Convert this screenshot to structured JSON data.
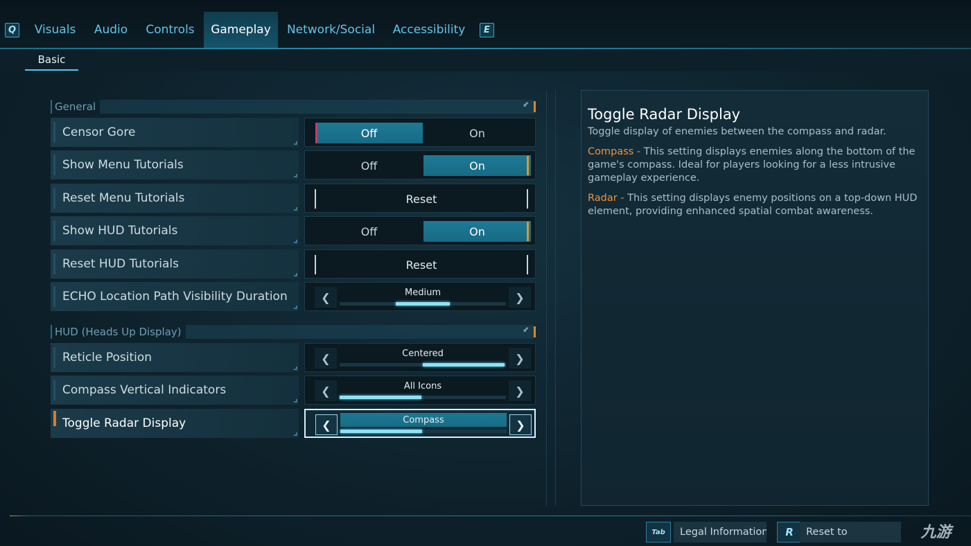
{
  "tabs": {
    "prev_key": "Q",
    "next_key": "E",
    "items": [
      "Visuals",
      "Audio",
      "Controls",
      "Gameplay",
      "Network/Social",
      "Accessibility"
    ],
    "active": "Gameplay"
  },
  "subtabs": {
    "active": "Basic"
  },
  "sections": {
    "general": "General",
    "hud": "HUD (Heads Up Display)"
  },
  "settings": {
    "censor_gore": {
      "label": "Censor Gore",
      "off": "Off",
      "on": "On",
      "value": "Off"
    },
    "show_menu_tutorials": {
      "label": "Show Menu Tutorials",
      "off": "Off",
      "on": "On",
      "value": "On"
    },
    "reset_menu_tutorials": {
      "label": "Reset Menu Tutorials",
      "button": "Reset"
    },
    "show_hud_tutorials": {
      "label": "Show HUD Tutorials",
      "off": "Off",
      "on": "On",
      "value": "On"
    },
    "reset_hud_tutorials": {
      "label": "Reset HUD Tutorials",
      "button": "Reset"
    },
    "echo_path_duration": {
      "label": "ECHO Location Path Visibility Duration",
      "value": "Medium",
      "position": 2,
      "options_count": 3
    },
    "reticle_position": {
      "label": "Reticle Position",
      "value": "Centered",
      "position": 2,
      "options_count": 2
    },
    "compass_vertical_indicators": {
      "label": "Compass Vertical Indicators",
      "value": "All Icons",
      "position": 1,
      "options_count": 2
    },
    "toggle_radar_display": {
      "label": "Toggle Radar Display",
      "value": "Compass",
      "position": 1,
      "options_count": 2
    }
  },
  "description": {
    "title": "Toggle Radar Display",
    "intro": "Toggle display of enemies between the compass and radar.",
    "compass_term": "Compass - ",
    "compass_text": "This setting displays enemies along the bottom of the game's compass. Ideal for players looking for a less intrusive gameplay experience.",
    "radar_term": "Radar - ",
    "radar_text": "This setting displays enemy positions on a top-down HUD element, providing enhanced spatial combat awareness."
  },
  "footer": {
    "legal_key": "Tab",
    "legal_label": "Legal Information",
    "reset_key": "R",
    "reset_label": "Reset to"
  },
  "watermark": "九游",
  "colors": {
    "accent": "#55c8ea",
    "highlight": "#f0923a",
    "active_toggle": "#1e7a96"
  }
}
